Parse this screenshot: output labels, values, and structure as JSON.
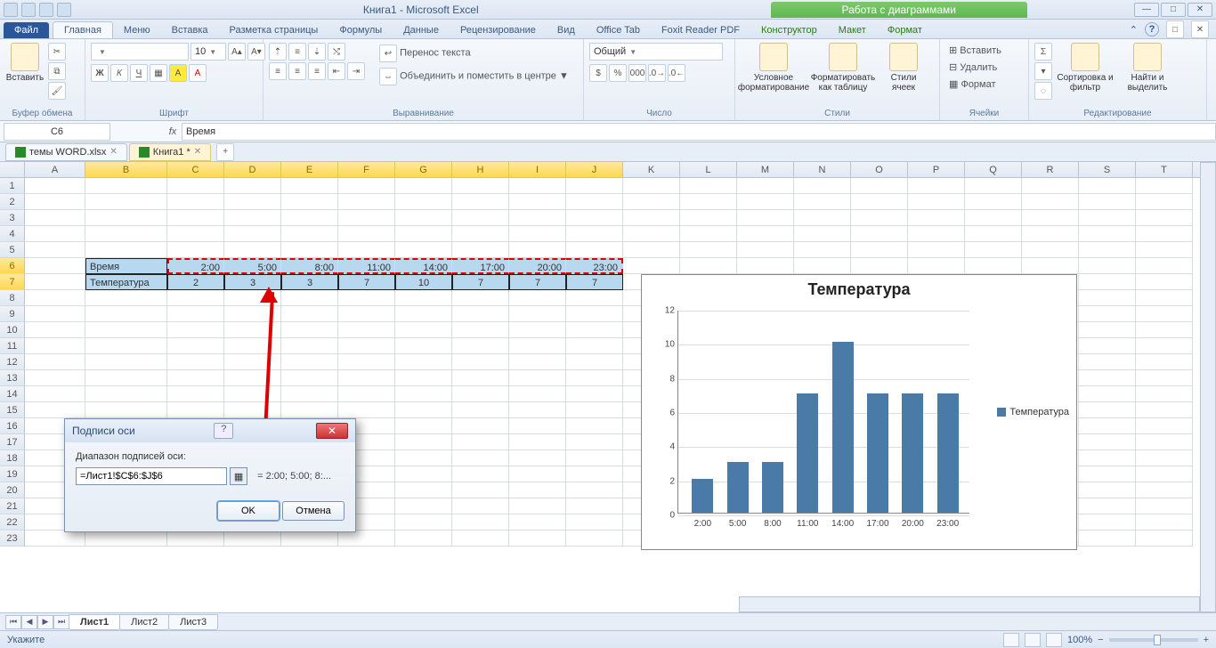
{
  "titlebar": {
    "title": "Книга1 - Microsoft Excel",
    "context_tab": "Работа с диаграммами"
  },
  "ribbon_tabs": {
    "file": "Файл",
    "items": [
      "Главная",
      "Меню",
      "Вставка",
      "Разметка страницы",
      "Формулы",
      "Данные",
      "Рецензирование",
      "Вид",
      "Office Tab",
      "Foxit Reader PDF"
    ],
    "ctx_items": [
      "Конструктор",
      "Макет",
      "Формат"
    ]
  },
  "ribbon": {
    "clipboard": {
      "label": "Буфер обмена",
      "paste": "Вставить"
    },
    "font": {
      "label": "Шрифт",
      "name": "",
      "size": "10",
      "bold": "Ж",
      "italic": "К",
      "underline": "Ч"
    },
    "align": {
      "label": "Выравнивание",
      "wrap": "Перенос текста",
      "merge": "Объединить и поместить в центре"
    },
    "number": {
      "label": "Число",
      "format": "Общий"
    },
    "styles": {
      "label": "Стили",
      "cond": "Условное форматирование",
      "table": "Форматировать как таблицу",
      "cell": "Стили ячеек"
    },
    "cells": {
      "label": "Ячейки",
      "insert": "Вставить",
      "delete": "Удалить",
      "format": "Формат"
    },
    "editing": {
      "label": "Редактирование",
      "sort": "Сортировка и фильтр",
      "find": "Найти и выделить"
    }
  },
  "formula_bar": {
    "namebox": "C6",
    "formula": "Время"
  },
  "doc_tabs": [
    {
      "label": "темы WORD.xlsx",
      "active": false
    },
    {
      "label": "Книга1 *",
      "active": true
    }
  ],
  "columns": [
    "A",
    "B",
    "C",
    "D",
    "E",
    "F",
    "G",
    "H",
    "I",
    "J",
    "K",
    "L",
    "M",
    "N",
    "O",
    "P",
    "Q",
    "R",
    "S",
    "T"
  ],
  "row_numbers": [
    1,
    2,
    3,
    4,
    5,
    6,
    7,
    8,
    9,
    10,
    11,
    12,
    13,
    14,
    15,
    16,
    17,
    18,
    19,
    20,
    21,
    22,
    23
  ],
  "table": {
    "row6_label": "Время",
    "row7_label": "Температура",
    "times": [
      "2:00",
      "5:00",
      "8:00",
      "11:00",
      "14:00",
      "17:00",
      "20:00",
      "23:00"
    ],
    "temps": [
      2,
      3,
      3,
      7,
      10,
      7,
      7,
      7
    ]
  },
  "dialog": {
    "title": "Подписи оси",
    "field_label": "Диапазон подписей оси:",
    "value": "=Лист1!$C$6:$J$6",
    "preview": "= 2:00; 5:00; 8:...",
    "ok": "OK",
    "cancel": "Отмена"
  },
  "sheet_tabs": [
    "Лист1",
    "Лист2",
    "Лист3"
  ],
  "statusbar": {
    "mode": "Укажите",
    "zoom": "100%"
  },
  "chart_data": {
    "type": "bar",
    "title": "Температура",
    "categories": [
      "2:00",
      "5:00",
      "8:00",
      "11:00",
      "14:00",
      "17:00",
      "20:00",
      "23:00"
    ],
    "series": [
      {
        "name": "Температура",
        "values": [
          2,
          3,
          3,
          7,
          10,
          7,
          7,
          7
        ]
      }
    ],
    "ylim": [
      0,
      12
    ],
    "yticks": [
      0,
      2,
      4,
      6,
      8,
      10,
      12
    ],
    "xlabel": "",
    "ylabel": ""
  }
}
